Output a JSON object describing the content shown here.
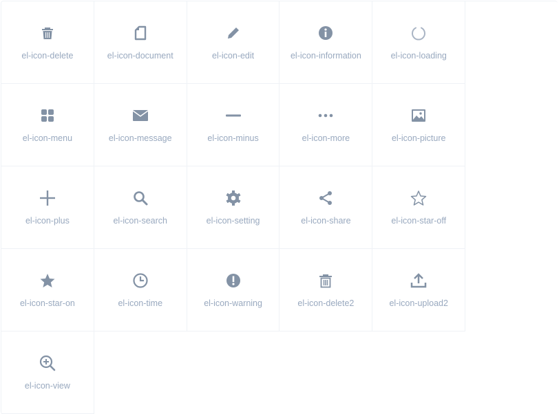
{
  "colors": {
    "icon": "#8392a5",
    "label": "#99a9bf",
    "border": "#eff2f6"
  },
  "icons": [
    {
      "name": "el-icon-delete",
      "icon": "trash-icon"
    },
    {
      "name": "el-icon-document",
      "icon": "document-icon"
    },
    {
      "name": "el-icon-edit",
      "icon": "pencil-icon"
    },
    {
      "name": "el-icon-information",
      "icon": "info-icon"
    },
    {
      "name": "el-icon-loading",
      "icon": "loading-icon"
    },
    {
      "name": "el-icon-menu",
      "icon": "menu-grid-icon"
    },
    {
      "name": "el-icon-message",
      "icon": "envelope-icon"
    },
    {
      "name": "el-icon-minus",
      "icon": "minus-icon"
    },
    {
      "name": "el-icon-more",
      "icon": "more-dots-icon"
    },
    {
      "name": "el-icon-picture",
      "icon": "picture-icon"
    },
    {
      "name": "el-icon-plus",
      "icon": "plus-icon"
    },
    {
      "name": "el-icon-search",
      "icon": "search-icon"
    },
    {
      "name": "el-icon-setting",
      "icon": "gear-icon"
    },
    {
      "name": "el-icon-share",
      "icon": "share-icon"
    },
    {
      "name": "el-icon-star-off",
      "icon": "star-outline-icon"
    },
    {
      "name": "el-icon-star-on",
      "icon": "star-filled-icon"
    },
    {
      "name": "el-icon-time",
      "icon": "clock-icon"
    },
    {
      "name": "el-icon-warning",
      "icon": "warning-icon"
    },
    {
      "name": "el-icon-delete2",
      "icon": "trash-outline-icon"
    },
    {
      "name": "el-icon-upload2",
      "icon": "upload-icon"
    },
    {
      "name": "el-icon-view",
      "icon": "zoom-in-icon"
    }
  ]
}
